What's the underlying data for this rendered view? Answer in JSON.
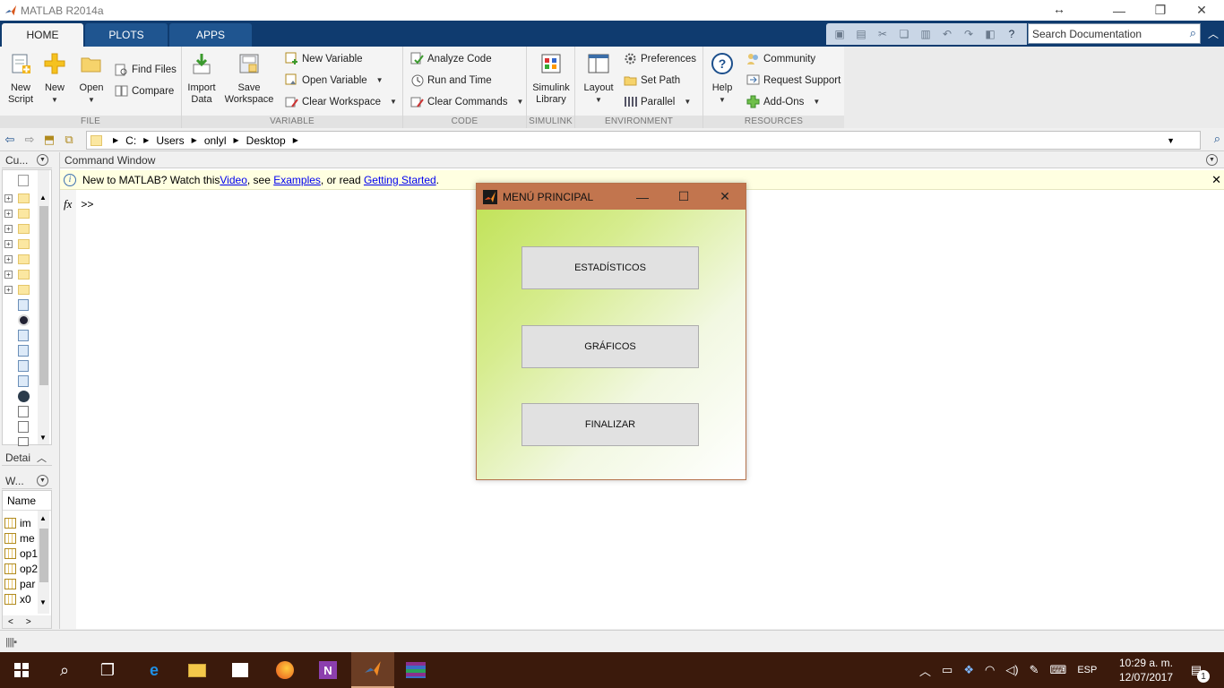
{
  "window": {
    "title": "MATLAB R2014a",
    "resize_glyph": "↔",
    "minimize_glyph": "—",
    "restore_glyph": "❐",
    "close_glyph": "✕"
  },
  "tabs": [
    {
      "label": "HOME"
    },
    {
      "label": "PLOTS"
    },
    {
      "label": "APPS"
    }
  ],
  "search": {
    "placeholder": "Search Documentation"
  },
  "ribbon": {
    "file": {
      "label": "FILE",
      "new_script": "New\nScript",
      "new": "New",
      "open": "Open",
      "find_files": "Find Files",
      "compare": "Compare"
    },
    "variable": {
      "label": "VARIABLE",
      "import_data": "Import\nData",
      "save_workspace": "Save\nWorkspace",
      "new_variable": "New Variable",
      "open_variable": "Open Variable",
      "clear_workspace": "Clear Workspace"
    },
    "code": {
      "label": "CODE",
      "analyze_code": "Analyze Code",
      "run_and_time": "Run and Time",
      "clear_commands": "Clear Commands"
    },
    "simulink": {
      "label": "SIMULINK",
      "simulink_library": "Simulink\nLibrary"
    },
    "environment": {
      "label": "ENVIRONMENT",
      "layout": "Layout",
      "preferences": "Preferences",
      "set_path": "Set Path",
      "parallel": "Parallel"
    },
    "resources": {
      "label": "RESOURCES",
      "help": "Help",
      "community": "Community",
      "request_support": "Request Support",
      "add_ons": "Add-Ons"
    }
  },
  "address": {
    "path": [
      "C:",
      "Users",
      "onlyl",
      "Desktop"
    ]
  },
  "left_panels": {
    "current_folder": "Cu...",
    "details": "Detai",
    "workspace": "W...",
    "workspace_header": "Name",
    "workspace_vars": [
      "im",
      "me",
      "op1",
      "op2",
      "par",
      "x0"
    ]
  },
  "command_window": {
    "title": "Command Window",
    "notice_prefix": "New to MATLAB? Watch this ",
    "notice_video": "Video",
    "notice_mid1": ", see ",
    "notice_examples": "Examples",
    "notice_mid2": ", or read ",
    "notice_getting_started": "Getting Started",
    "notice_suffix": ".",
    "fx": "fx",
    "prompt": ">>"
  },
  "figure": {
    "title": "MENÚ PRINCIPAL",
    "buttons": [
      {
        "label": "ESTADÍSTICOS"
      },
      {
        "label": "GRÁFICOS"
      },
      {
        "label": "FINALIZAR"
      }
    ],
    "gradient_colors": [
      "#c2e35a",
      "#ffffff"
    ],
    "titlebar_color": "#c2754e"
  },
  "taskbar": {
    "language": "ESP",
    "time": "10:29 a. m.",
    "date": "12/07/2017",
    "notification_count": "1"
  },
  "colors": {
    "tabstrip": "#0f3b6f",
    "taskbar": "#3b1a0c",
    "notice_bg": "#ffffe1"
  }
}
